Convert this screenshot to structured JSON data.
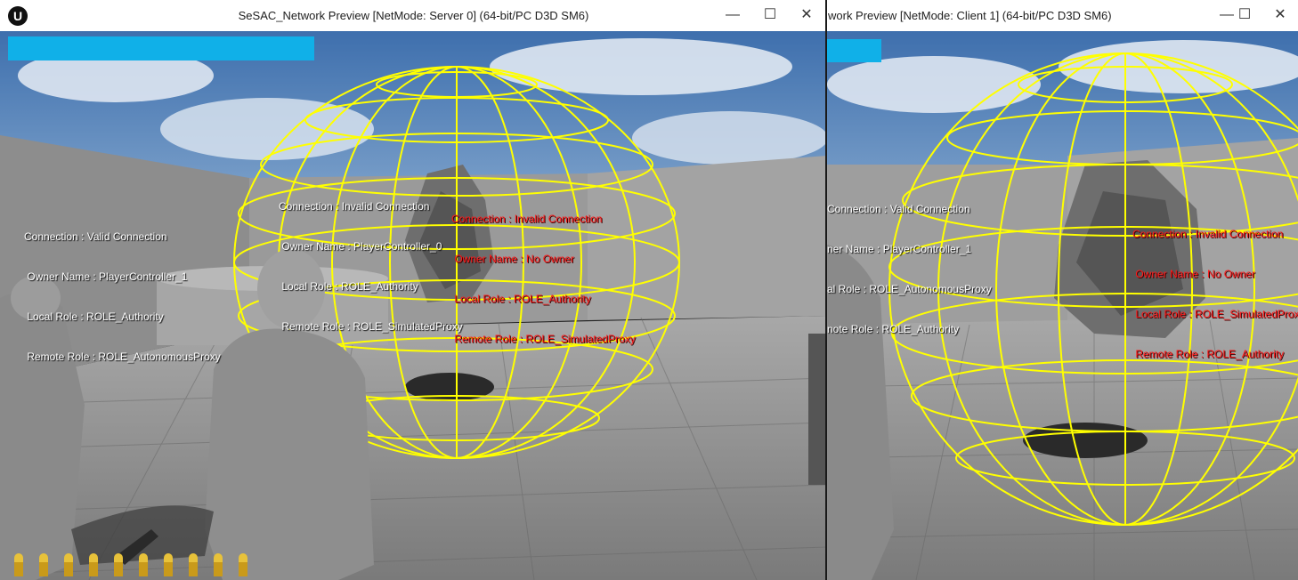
{
  "server": {
    "title": "SeSAC_Network Preview [NetMode: Server 0]  (64-bit/PC D3D SM6)",
    "controls": {
      "minimize": "—",
      "maximize": "☐",
      "close": "✕"
    },
    "logo": "U",
    "health_percent": 100,
    "ammo_count": 10,
    "debug_player": [
      "Connection : Valid Connection",
      " Owner Name : PlayerController_1",
      " Local Role : ROLE_Authority",
      " Remote Role : ROLE_AutonomousProxy"
    ],
    "debug_player2": [
      "Connection : Invalid Connection",
      " Owner Name : PlayerController_0",
      " Local Role : ROLE_Authority",
      " Remote Role : ROLE_SimulatedProxy"
    ],
    "debug_rock": [
      "Connection : Invalid Connection",
      " Owner Name : No Owner",
      " Local Role : ROLE_Authority",
      " Remote Role : ROLE_SimulatedProxy"
    ]
  },
  "client": {
    "title": "work Preview [NetMode: Client 1]  (64-bit/PC D3D SM6)",
    "controls": {
      "minimize": "—",
      "maximize": "☐",
      "close": "✕"
    },
    "health_percent": 100,
    "debug_player": [
      "Connection : Valid Connection",
      "ner Name : PlayerController_1",
      "al Role : ROLE_AutonomousProxy",
      "note Role : ROLE_Authority"
    ],
    "debug_rock": [
      "Connection : Invalid Connection",
      " Owner Name : No Owner",
      " Local Role : ROLE_SimulatedProxy",
      " Remote Role : ROLE_Authority"
    ]
  },
  "colors": {
    "sky": "#4f7fb8",
    "cloud": "#e8eef6",
    "floor": "#8f8f8f",
    "wall": "#9c9c9c",
    "sphere": "#ffff00",
    "hud_bar": "#10b0e8"
  },
  "icons": {
    "bullet": "bullet-icon",
    "logo": "unreal-logo-icon"
  }
}
